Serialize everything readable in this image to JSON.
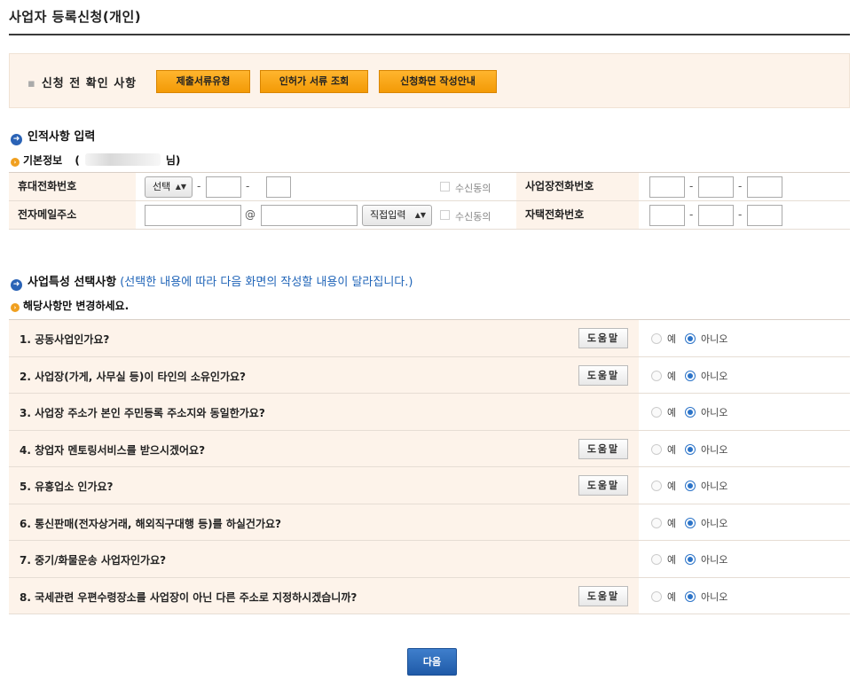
{
  "page": {
    "title": "사업자 등록신청(개인)"
  },
  "pre_check": {
    "label": "신청 전 확인 사항",
    "buttons": [
      "제출서류유형",
      "인허가 서류 조회",
      "신청화면 작성안내"
    ]
  },
  "personal": {
    "section_title": "인적사항 입력",
    "basic_info": {
      "label": "기본정보",
      "open_paren": "(",
      "suffix": "님)"
    },
    "mobile": {
      "label": "휴대전화번호",
      "select_value": "선택",
      "dash": "-",
      "consent": "수신동의"
    },
    "email": {
      "label": "전자메일주소",
      "at": "@",
      "domain_select": "직접입력",
      "consent": "수신동의"
    },
    "business_phone": {
      "label": "사업장전화번호",
      "dash": "-"
    },
    "home_phone": {
      "label": "자택전화번호",
      "dash": "-"
    }
  },
  "business": {
    "section_title": "사업특성 선택사항",
    "note": "(선택한 내용에 따라 다음 화면의 작성할 내용이 달라집니다.)",
    "sub_label": "해당사항만 변경하세요.",
    "help_label": "도움말",
    "yes_label": "예",
    "no_label": "아니오",
    "questions": [
      {
        "text": "1. 공동사업인가요?",
        "help": true,
        "answer": "no"
      },
      {
        "text": "2. 사업장(가게, 사무실 등)이 타인의 소유인가요?",
        "help": true,
        "answer": "no"
      },
      {
        "text": "3. 사업장 주소가 본인 주민등록 주소지와 동일한가요?",
        "help": false,
        "answer": "no"
      },
      {
        "text": "4. 창업자 멘토링서비스를 받으시겠어요?",
        "help": true,
        "answer": "no"
      },
      {
        "text": "5. 유흥업소 인가요?",
        "help": true,
        "answer": "no"
      },
      {
        "text": "6. 통신판매(전자상거래, 해외직구대행 등)를 하실건가요?",
        "help": false,
        "answer": "no"
      },
      {
        "text": "7. 중기/화물운송 사업자인가요?",
        "help": false,
        "answer": "no"
      },
      {
        "text": "8. 국세관련 우편수령장소를 사업장이 아닌 다른 주소로 지정하시겠습니까?",
        "help": true,
        "answer": "no"
      }
    ]
  },
  "footer": {
    "next_label": "다음"
  },
  "colors": {
    "accent_blue": "#2a63b6",
    "orange_button": "#f39a06",
    "panel_bg": "#fdf3ea"
  }
}
